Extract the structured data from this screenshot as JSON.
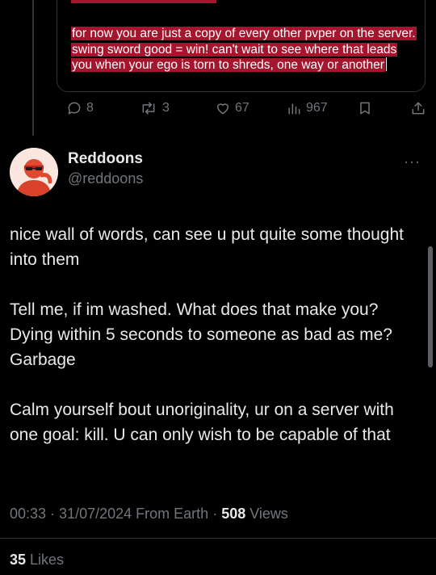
{
  "quoted_post": {
    "text": "for now you are just a copy of every other pvper on the server. swing sword good = win! can't wait to see where that leads you when your ego is torn to shreds, one way or another"
  },
  "actions": {
    "replies": "8",
    "reposts": "3",
    "likes": "67",
    "views": "967"
  },
  "post": {
    "author_name": "Reddoons",
    "author_handle": "@reddoons",
    "more_label": "···",
    "paragraphs": [
      "nice wall of words, can see u put quite some thought into them",
      "Tell me, if im washed. What does that make you? Dying within 5 seconds to someone as bad as me? Garbage",
      "Calm yourself bout unoriginality, ur on a server with one goal: kill. U can only wish to be capable of that"
    ],
    "time": "00:33",
    "date": "31/07/2024",
    "location": "From Earth",
    "sep": " · ",
    "views_count": "508",
    "views_label": " Views",
    "likes_count": "35",
    "likes_label": " Likes"
  },
  "colors": {
    "background": "#000000",
    "text": "#e7e9ea",
    "muted": "#71767b",
    "highlight": "#a3162d",
    "avatar_bg": "#fbe7df",
    "avatar_figure": "#e0492f"
  }
}
